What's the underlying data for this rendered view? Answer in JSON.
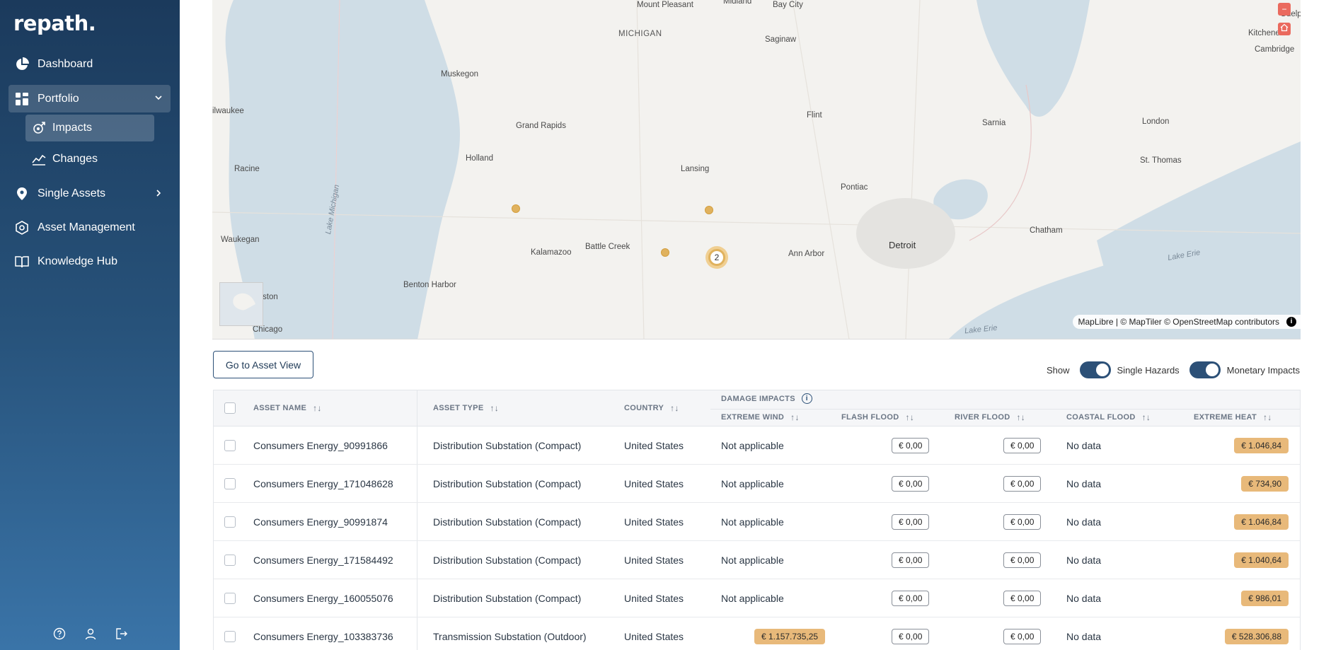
{
  "brand": {
    "logo": "repath."
  },
  "sidebar": {
    "items": [
      {
        "label": "Dashboard"
      },
      {
        "label": "Portfolio"
      },
      {
        "label": "Single Assets"
      },
      {
        "label": "Asset Management"
      },
      {
        "label": "Knowledge Hub"
      }
    ],
    "subitems": [
      {
        "label": "Impacts"
      },
      {
        "label": "Changes"
      }
    ],
    "footer_icons": [
      "help-icon",
      "user-icon",
      "logout-icon"
    ]
  },
  "map": {
    "cities": [
      "Mount Pleasant",
      "Midland",
      "Bay City",
      "MICHIGAN",
      "Saginaw",
      "Muskegon",
      "Flint",
      "Grand Rapids",
      "Holland",
      "Lansing",
      "Pontiac",
      "Racine",
      "Waukegan",
      "Kalamazoo",
      "Battle Creek",
      "Ann Arbor",
      "Detroit",
      "Benton Harbor",
      "Sarnia",
      "London",
      "St. Thomas",
      "Chatham",
      "Chicago",
      "Kitchener",
      "Cambridge",
      "Guelph",
      "ilwaukee",
      "ston"
    ],
    "water": [
      "Lake Michigan",
      "Lake Erie",
      "Lake Erie"
    ],
    "cluster_count": "2",
    "attribution": "MapLibre | © MapTiler © OpenStreetMap contributors",
    "info_glyph": "i",
    "controls": [
      "minus-icon",
      "home-icon"
    ],
    "colors": {
      "marker": "#e0b25e",
      "water": "#cfdde6",
      "land": "#f3f2ef"
    }
  },
  "controls": {
    "asset_view_button": "Go to Asset View",
    "show_label": "Show",
    "toggle_single_hazards": "Single Hazards",
    "toggle_monetary_impacts": "Monetary Impacts"
  },
  "table": {
    "headers": {
      "asset_name": "ASSET NAME",
      "asset_type": "ASSET TYPE",
      "country": "COUNTRY",
      "damage_impacts": "DAMAGE IMPACTS",
      "extreme_wind": "EXTREME WIND",
      "flash_flood": "FLASH FLOOD",
      "river_flood": "RIVER FLOOD",
      "coastal_flood": "COASTAL FLOOD",
      "extreme_heat": "EXTREME HEAT"
    },
    "sort_glyph": "↑↓",
    "rows": [
      {
        "name": "Consumers Energy_90991866",
        "type": "Distribution Substation (Compact)",
        "country": "United States",
        "wind": "Not applicable",
        "flash": "€ 0,00",
        "river": "€ 0,00",
        "coastal": "No data",
        "heat": "€ 1.046,84"
      },
      {
        "name": "Consumers Energy_171048628",
        "type": "Distribution Substation (Compact)",
        "country": "United States",
        "wind": "Not applicable",
        "flash": "€ 0,00",
        "river": "€ 0,00",
        "coastal": "No data",
        "heat": "€ 734,90"
      },
      {
        "name": "Consumers Energy_90991874",
        "type": "Distribution Substation (Compact)",
        "country": "United States",
        "wind": "Not applicable",
        "flash": "€ 0,00",
        "river": "€ 0,00",
        "coastal": "No data",
        "heat": "€ 1.046,84"
      },
      {
        "name": "Consumers Energy_171584492",
        "type": "Distribution Substation (Compact)",
        "country": "United States",
        "wind": "Not applicable",
        "flash": "€ 0,00",
        "river": "€ 0,00",
        "coastal": "No data",
        "heat": "€ 1.040,64"
      },
      {
        "name": "Consumers Energy_160055076",
        "type": "Distribution Substation (Compact)",
        "country": "United States",
        "wind": "Not applicable",
        "flash": "€ 0,00",
        "river": "€ 0,00",
        "coastal": "No data",
        "heat": "€ 986,01"
      },
      {
        "name": "Consumers Energy_103383736",
        "type": "Transmission Substation (Outdoor)",
        "country": "United States",
        "wind": "€ 1.157.735,25",
        "flash": "€ 0,00",
        "river": "€ 0,00",
        "coastal": "No data",
        "heat": "€ 528.306,88"
      }
    ]
  }
}
